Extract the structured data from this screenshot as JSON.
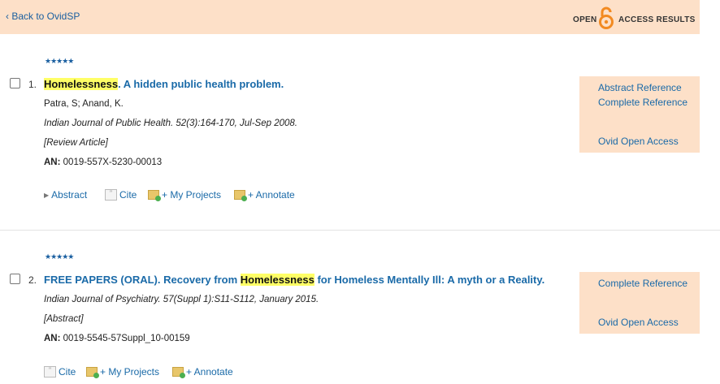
{
  "header": {
    "back_label": "‹ Back to OvidSP",
    "oa_open": "OPEN",
    "oa_rest": "ACCESS RESULTS"
  },
  "results": [
    {
      "stars": "★★★★★",
      "number": "1.",
      "title_highlight": "Homelessness",
      "title_rest": ". A hidden public health problem.",
      "authors": "Patra, S; Anand, K.",
      "source": "Indian Journal of Public Health. 52(3):164-170, Jul-Sep 2008.",
      "type": "[Review Article]",
      "an_label": "AN:",
      "an_value": " 0019-557X-5230-00013",
      "actions": {
        "abstract": "Abstract",
        "cite": "Cite",
        "projects": "+ My Projects",
        "annotate": "+ Annotate"
      },
      "links": [
        "Abstract Reference",
        "Complete Reference",
        "Ovid Open Access"
      ]
    },
    {
      "stars": "★★★★★",
      "number": "2.",
      "title_pre": "FREE PAPERS (ORAL). Recovery from ",
      "title_highlight": "Homelessness",
      "title_rest": " for Homeless Mentally Ill: A myth or a Reality.",
      "source": "Indian Journal of Psychiatry. 57(Suppl 1):S11-S112, January 2015.",
      "type": "[Abstract]",
      "an_label": "AN:",
      "an_value": " 0019-5545-57Suppl_10-00159",
      "actions": {
        "cite": "Cite",
        "projects": "+ My Projects",
        "annotate": "+ Annotate"
      },
      "links": [
        "Complete Reference",
        "Ovid Open Access"
      ]
    }
  ]
}
